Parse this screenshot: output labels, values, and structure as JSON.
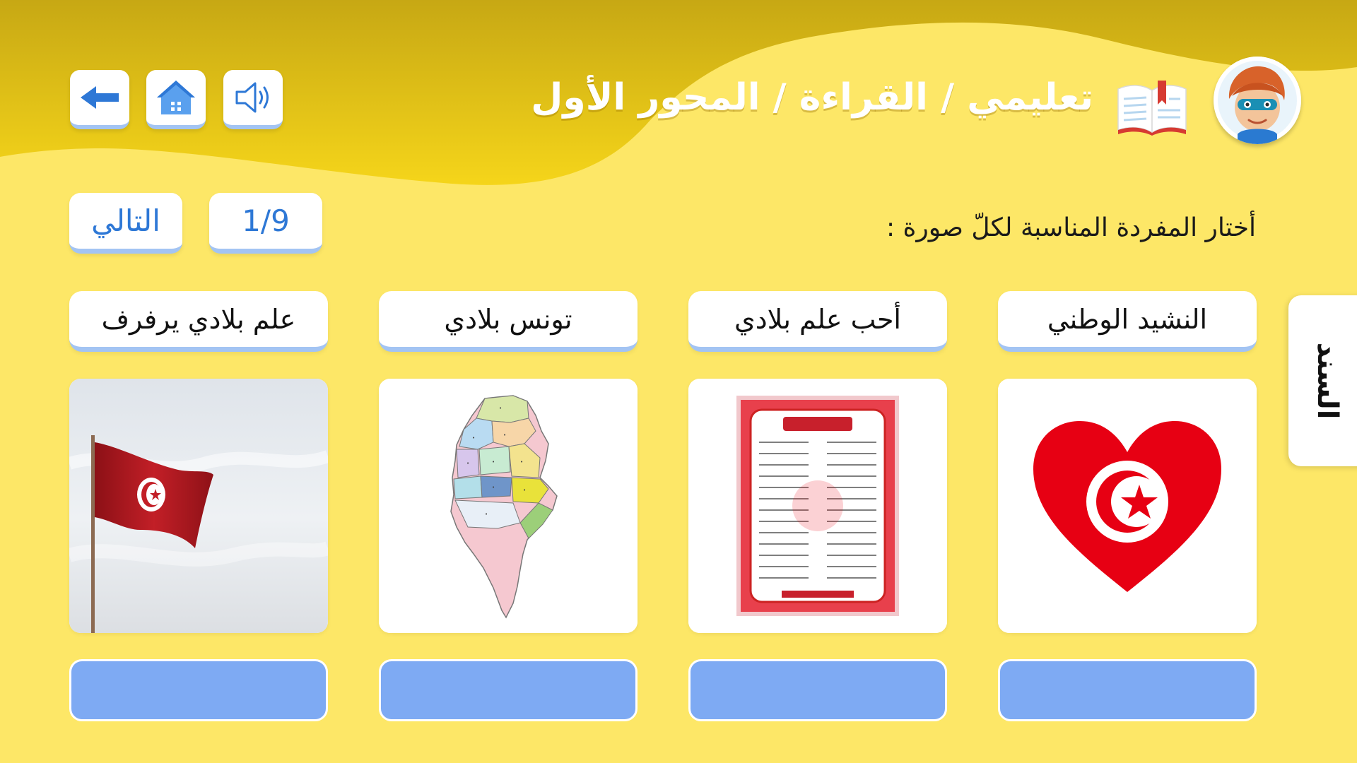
{
  "header": {
    "breadcrumb": "تعليمي / القراءة / المحور الأول",
    "book_icon": "book-icon",
    "avatar_icon": "boy-avatar"
  },
  "toolbar": {
    "sound_icon": "speaker-icon",
    "home_icon": "home-icon",
    "back_icon": "back-arrow-icon"
  },
  "navigation": {
    "next_label": "التالي",
    "progress": "1/9"
  },
  "instruction": "أختار المفردة المناسبة لكلّ صورة :",
  "side_tab": {
    "label": "السند"
  },
  "word_cards": [
    "النشيد الوطني",
    "أحب علم بلادي",
    "تونس بلادي",
    "علم بلادي يرفرف"
  ],
  "image_cards": [
    {
      "icon": "tunisian-flag-heart-image"
    },
    {
      "icon": "national-anthem-poster-image"
    },
    {
      "icon": "tunisia-map-image"
    },
    {
      "icon": "waving-flag-image"
    }
  ],
  "answer_boxes": [
    "",
    "",
    "",
    ""
  ],
  "colors": {
    "background": "#fde767",
    "accent_blue": "#2e78d6",
    "answer_box": "#7eaaf3",
    "border_blue": "#a3c4f3",
    "flag_red": "#e70013"
  }
}
